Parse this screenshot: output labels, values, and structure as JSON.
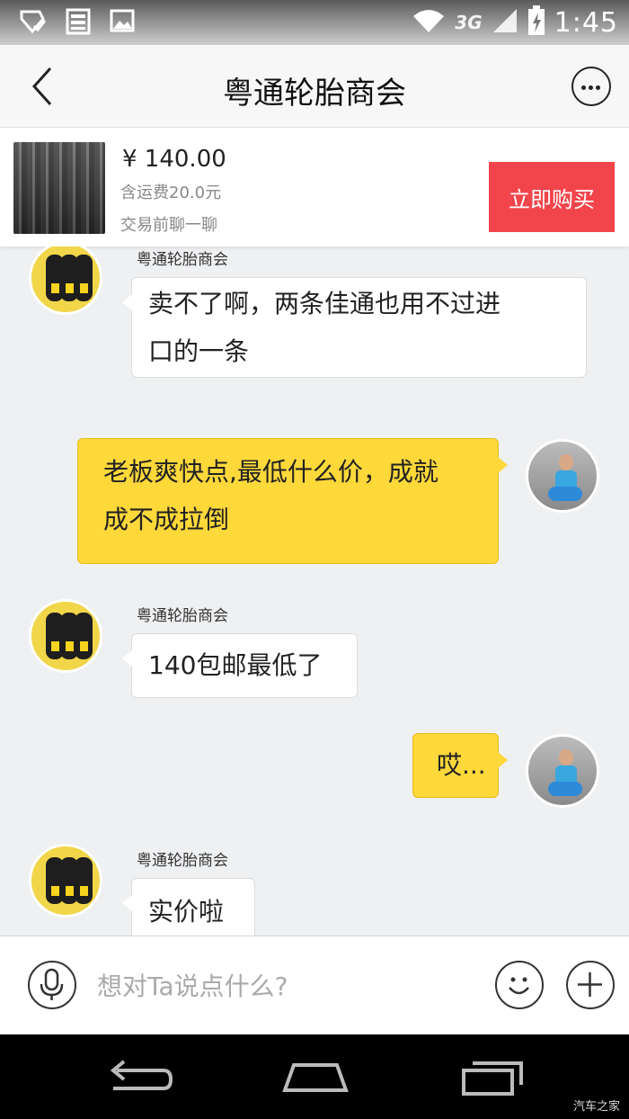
{
  "status_bar": {
    "time": "1:45",
    "network": "3G",
    "icons": [
      "notification-icon",
      "sim-icon",
      "image-icon",
      "wifi-icon",
      "signal-icon",
      "battery-charging-icon"
    ]
  },
  "header": {
    "title": "粤通轮胎商会",
    "back_icon": "chevron-left-icon",
    "more_icon": "more-options-icon"
  },
  "product": {
    "price": "¥ 140.00",
    "shipping": "含运费20.0元",
    "chat_note": "交易前聊一聊",
    "buy_label": "立即购买"
  },
  "messages": [
    {
      "side": "left",
      "sender": "粤通轮胎商会",
      "lines": [
        "卖不了啊，两条佳通也用不过进",
        "口的一条"
      ]
    },
    {
      "side": "right",
      "lines": [
        "老板爽快点,最低什么价，成就",
        "成不成拉倒"
      ]
    },
    {
      "side": "left",
      "sender": "粤通轮胎商会",
      "lines": [
        "140包邮最低了"
      ]
    },
    {
      "side": "right",
      "lines": [
        "哎..."
      ]
    },
    {
      "side": "left",
      "sender": "粤通轮胎商会",
      "lines": [
        "实价啦"
      ]
    }
  ],
  "input_bar": {
    "placeholder": "想对Ta说点什么?",
    "value": ""
  },
  "watermark": "汽车之家",
  "colors": {
    "buy_button": "#f2454b",
    "my_bubble": "#ffd83a",
    "their_bubble": "#ffffff",
    "chat_background": "#eff0f2"
  }
}
